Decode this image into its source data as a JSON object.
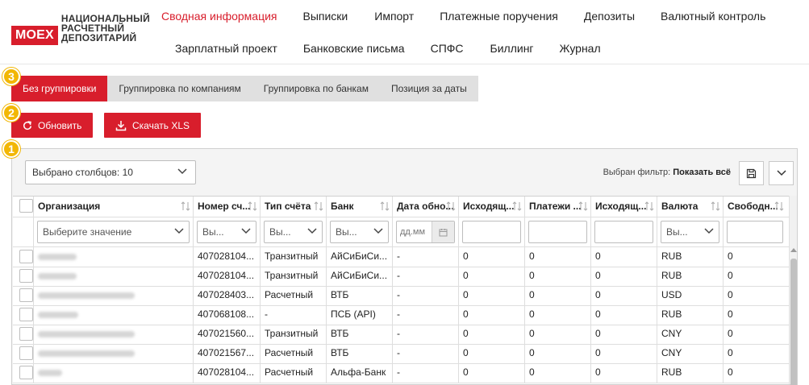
{
  "logo": {
    "badge": "MOEX",
    "lines": [
      "НАЦИОНАЛЬНЫЙ",
      "РАСЧЕТНЫЙ",
      "ДЕПОЗИТАРИЙ"
    ]
  },
  "nav": {
    "row1": [
      {
        "label": "Сводная информация",
        "active": true
      },
      {
        "label": "Выписки"
      },
      {
        "label": "Импорт"
      },
      {
        "label": "Платежные поручения"
      },
      {
        "label": "Депозиты"
      },
      {
        "label": "Валютный контроль"
      }
    ],
    "row2": [
      {
        "label": "Зарплатный проект"
      },
      {
        "label": "Банковские письма"
      },
      {
        "label": "СПФС"
      },
      {
        "label": "Биллинг"
      },
      {
        "label": "Журнал"
      }
    ]
  },
  "steps": [
    "3",
    "2",
    "1"
  ],
  "grouping_tabs": [
    {
      "label": "Без группировки",
      "active": true
    },
    {
      "label": "Группировка по компаниям"
    },
    {
      "label": "Группировка по банкам"
    },
    {
      "label": "Позиция за даты"
    }
  ],
  "actions": {
    "refresh": "Обновить",
    "download": "Скачать XLS"
  },
  "toolbar": {
    "columns_select": "Выбрано столбцов: 10",
    "filter_label": "Выбран фильтр:",
    "filter_value": "Показать всё"
  },
  "columns": [
    "Организация",
    "Номер сч...",
    "Тип счёта",
    "Банк",
    "Дата обно...",
    "Исходящ...",
    "Платежи ...",
    "Исходящ...",
    "Валюта",
    "Свободн..."
  ],
  "filters": {
    "org": "Выберите значение",
    "account": "Вы...",
    "type": "Вы...",
    "bank": "Вы...",
    "date": "дд.мм",
    "currency": "Вы..."
  },
  "rows": [
    {
      "account": "407028104...",
      "type": "Транзитный",
      "bank": "АйСиБиСи...",
      "date": "-",
      "out1": "0",
      "payments": "0",
      "out2": "0",
      "currency": "RUB",
      "free": "0"
    },
    {
      "account": "407028104...",
      "type": "Транзитный",
      "bank": "АйСиБиСи...",
      "date": "-",
      "out1": "0",
      "payments": "0",
      "out2": "0",
      "currency": "RUB",
      "free": "0"
    },
    {
      "account": "407028403...",
      "type": "Расчетный",
      "bank": "ВТБ",
      "date": "-",
      "out1": "0",
      "payments": "0",
      "out2": "0",
      "currency": "USD",
      "free": "0"
    },
    {
      "account": "407068108...",
      "type": "-",
      "bank": "ПСБ (API)",
      "date": "-",
      "out1": "0",
      "payments": "0",
      "out2": "0",
      "currency": "RUB",
      "free": "0"
    },
    {
      "account": "407021560...",
      "type": "Транзитный",
      "bank": "ВТБ",
      "date": "-",
      "out1": "0",
      "payments": "0",
      "out2": "0",
      "currency": "CNY",
      "free": "0"
    },
    {
      "account": "407021567...",
      "type": "Расчетный",
      "bank": "ВТБ",
      "date": "-",
      "out1": "0",
      "payments": "0",
      "out2": "0",
      "currency": "CNY",
      "free": "0"
    },
    {
      "account": "407028104...",
      "type": "Расчетный",
      "bank": "Альфа-Банк",
      "date": "-",
      "out1": "0",
      "payments": "0",
      "out2": "0",
      "currency": "RUB",
      "free": "0"
    }
  ],
  "colors": {
    "accent": "#d81e2c",
    "badge": "#f2b705"
  }
}
